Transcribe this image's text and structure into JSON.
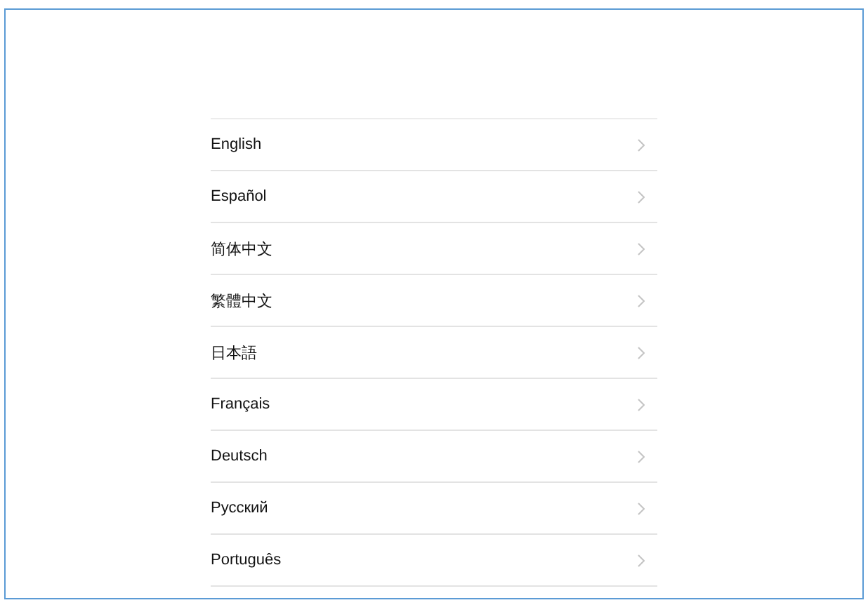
{
  "languages": [
    {
      "label": "English"
    },
    {
      "label": "Español"
    },
    {
      "label": "简体中文"
    },
    {
      "label": "繁體中文"
    },
    {
      "label": "日本語"
    },
    {
      "label": "Français"
    },
    {
      "label": "Deutsch"
    },
    {
      "label": "Русский"
    },
    {
      "label": "Português"
    }
  ]
}
